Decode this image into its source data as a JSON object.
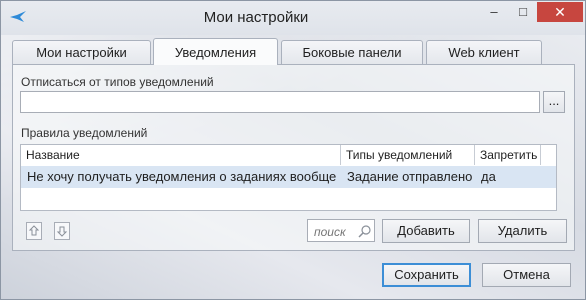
{
  "window": {
    "title": "Мои настройки",
    "minimize": "–",
    "maximize": "□",
    "close": "✕"
  },
  "tabs": [
    {
      "label": "Мои настройки",
      "active": false
    },
    {
      "label": "Уведомления",
      "active": true
    },
    {
      "label": "Боковые панели",
      "active": false
    },
    {
      "label": "Web клиент",
      "active": false
    }
  ],
  "unsubscribe": {
    "label": "Отписаться от типов уведомлений",
    "value": "",
    "browse_label": "..."
  },
  "rules": {
    "label": "Правила уведомлений",
    "columns": [
      "Название",
      "Типы уведомлений",
      "Запретить"
    ],
    "rows": [
      {
        "name": "Не хочу получать уведомления о заданиях вообще",
        "types": "Задание отправлено",
        "forbid": "да"
      }
    ]
  },
  "search": {
    "placeholder": "поиск"
  },
  "actions": {
    "add": "Добавить",
    "delete": "Удалить"
  },
  "footer": {
    "save": "Сохранить",
    "cancel": "Отмена"
  },
  "colors": {
    "close_bg": "#c7463f",
    "selected_row": "#d9e5f3",
    "accent": "#2e8ad8"
  }
}
